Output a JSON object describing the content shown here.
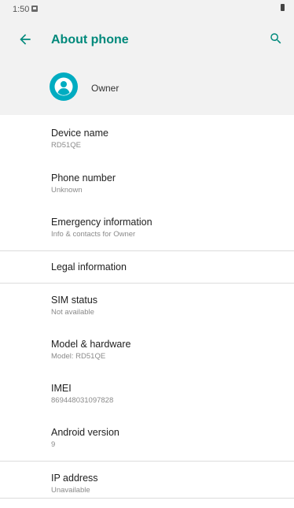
{
  "status_bar": {
    "time": "1:50",
    "notification_icon": "image-notification-icon",
    "battery_icon": "battery-icon"
  },
  "app_bar": {
    "title": "About phone",
    "back_icon": "arrow-back-icon",
    "search_icon": "search-icon",
    "accent_color": "#00897b"
  },
  "owner": {
    "name": "Owner",
    "avatar_icon": "account-circle-icon",
    "avatar_color": "#00acc1"
  },
  "items": [
    {
      "title": "Device name",
      "subtitle": "RD51QE"
    },
    {
      "title": "Phone number",
      "subtitle": "Unknown"
    },
    {
      "title": "Emergency information",
      "subtitle": "Info & contacts for Owner"
    },
    {
      "title": "Legal information",
      "subtitle": ""
    },
    {
      "title": "SIM status",
      "subtitle": "Not available"
    },
    {
      "title": "Model & hardware",
      "subtitle": "Model: RD51QE"
    },
    {
      "title": "IMEI",
      "subtitle": "869448031097828"
    },
    {
      "title": "Android version",
      "subtitle": "9"
    },
    {
      "title": "IP address",
      "subtitle": "Unavailable"
    }
  ]
}
